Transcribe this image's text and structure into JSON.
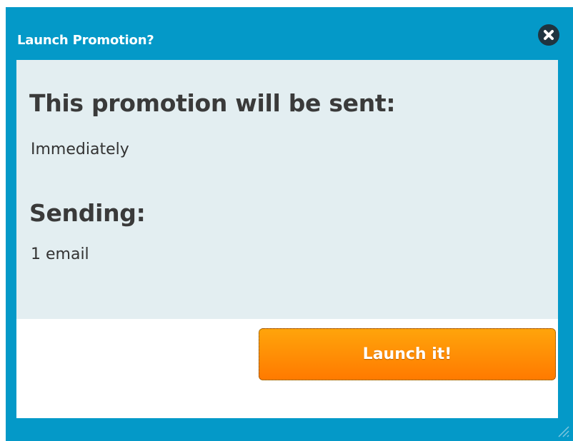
{
  "dialog": {
    "title": "Launch Promotion?",
    "close_icon": "close-icon",
    "colors": {
      "frame": "#0499c8",
      "content_bg": "#e3eef1",
      "button_top": "#ffa40b",
      "button_bottom": "#ff7a00"
    }
  },
  "content": {
    "sent_heading": "This promotion will be sent:",
    "sent_value": "Immediately",
    "sending_heading": "Sending:",
    "sending_value": "1 email"
  },
  "footer": {
    "launch_label": "Launch it!"
  }
}
